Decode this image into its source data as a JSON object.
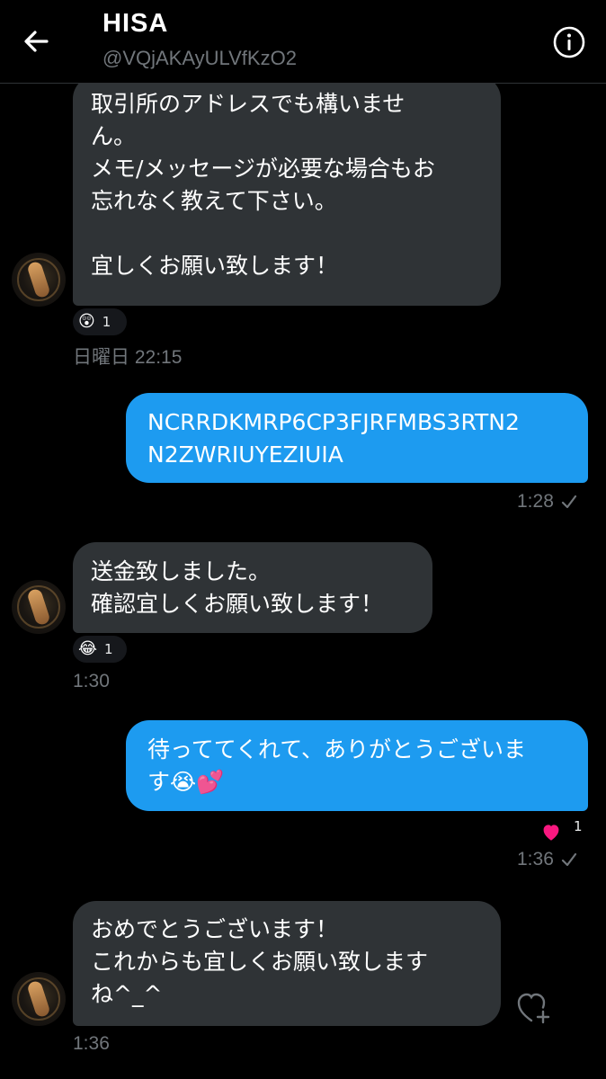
{
  "header": {
    "name": "HISA",
    "handle": "@VQjAKAyULVfKzO2"
  },
  "messages": [
    {
      "lines": [
        "取引所のアドレスでも構いませ",
        "ん。",
        "メモ/メッセージが必要な場合もお",
        "忘れなく教えて下さい。",
        "",
        "宜しくお願い致します！"
      ],
      "reaction": {
        "emoji": "😲",
        "count": "1"
      },
      "time": "日曜日 22:15"
    },
    {
      "lines": [
        "NCRRDKMRP6CP3FJRFMBS3RTN2",
        "N2ZWRIUYEZIUIA"
      ],
      "time": "1:28"
    },
    {
      "lines": [
        "送金致しました。",
        "確認宜しくお願い致します！"
      ],
      "reaction": {
        "emoji": "😂",
        "count": "1"
      },
      "time": "1:30"
    },
    {
      "lines": [
        "待っててくれて、ありがとうございま",
        "す😭💕"
      ],
      "reaction": {
        "emoji": "❤️",
        "count": "1"
      },
      "time": "1:36"
    },
    {
      "lines": [
        "おめでとうございます！",
        "これからも宜しくお願い致します",
        "ね^_^"
      ],
      "time": "1:36"
    }
  ],
  "colors": {
    "background": "#000000",
    "incoming_bubble": "#2f3336",
    "outgoing_bubble": "#1d9bf0",
    "timestamp": "#71767b",
    "heart": "#f91880"
  },
  "icons": {
    "back": "arrow-left-icon",
    "info": "info-circle-icon",
    "read": "check-icon",
    "like": "heart-plus-icon"
  }
}
